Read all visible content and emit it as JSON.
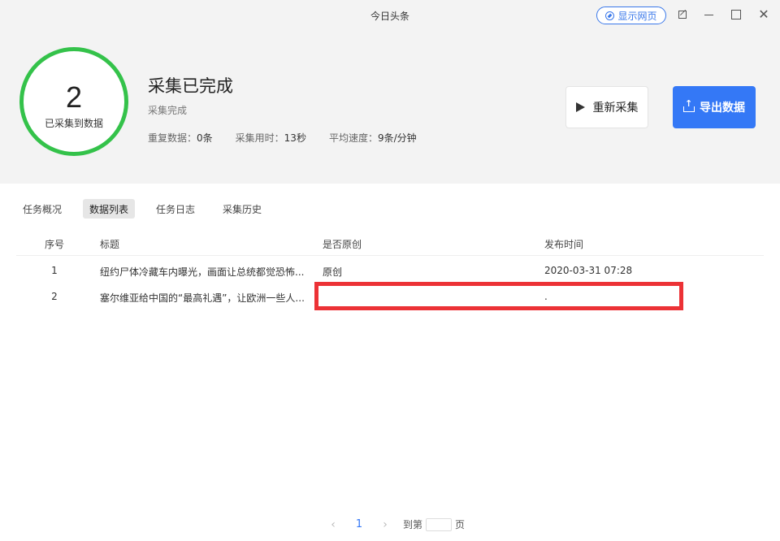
{
  "window": {
    "title": "今日头条",
    "show_web_label": "显示网页"
  },
  "summary": {
    "count": "2",
    "count_label": "已采集到数据",
    "title": "采集已完成",
    "subtitle": "采集完成",
    "stats": [
      {
        "label": "重复数据：",
        "value": "0条"
      },
      {
        "label": "采集用时：",
        "value": "13秒"
      },
      {
        "label": "平均速度：",
        "value": "9条/分钟"
      }
    ],
    "recollect_label": "重新采集",
    "export_label": "导出数据",
    "ring_color": "#34c24a",
    "accent_color": "#3478f6"
  },
  "tabs": [
    {
      "label": "任务概况",
      "active": false
    },
    {
      "label": "数据列表",
      "active": true
    },
    {
      "label": "任务日志",
      "active": false
    },
    {
      "label": "采集历史",
      "active": false
    }
  ],
  "table": {
    "columns": [
      "序号",
      "标题",
      "是否原创",
      "发布时间"
    ],
    "rows": [
      {
        "no": "1",
        "title": "纽约尸体冷藏车内曝光，画面让总统都觉恐怖...",
        "original": "原创",
        "time": "2020-03-31 07:28"
      },
      {
        "no": "2",
        "title": "塞尔维亚给中国的“最高礼遇”，让欧洲一些人...",
        "original": "",
        "time": "."
      }
    ]
  },
  "pager": {
    "prev": "‹",
    "current": "1",
    "next": "›",
    "goto_label": "到第",
    "page_suffix": "页"
  },
  "highlight_color": "#ec3236"
}
